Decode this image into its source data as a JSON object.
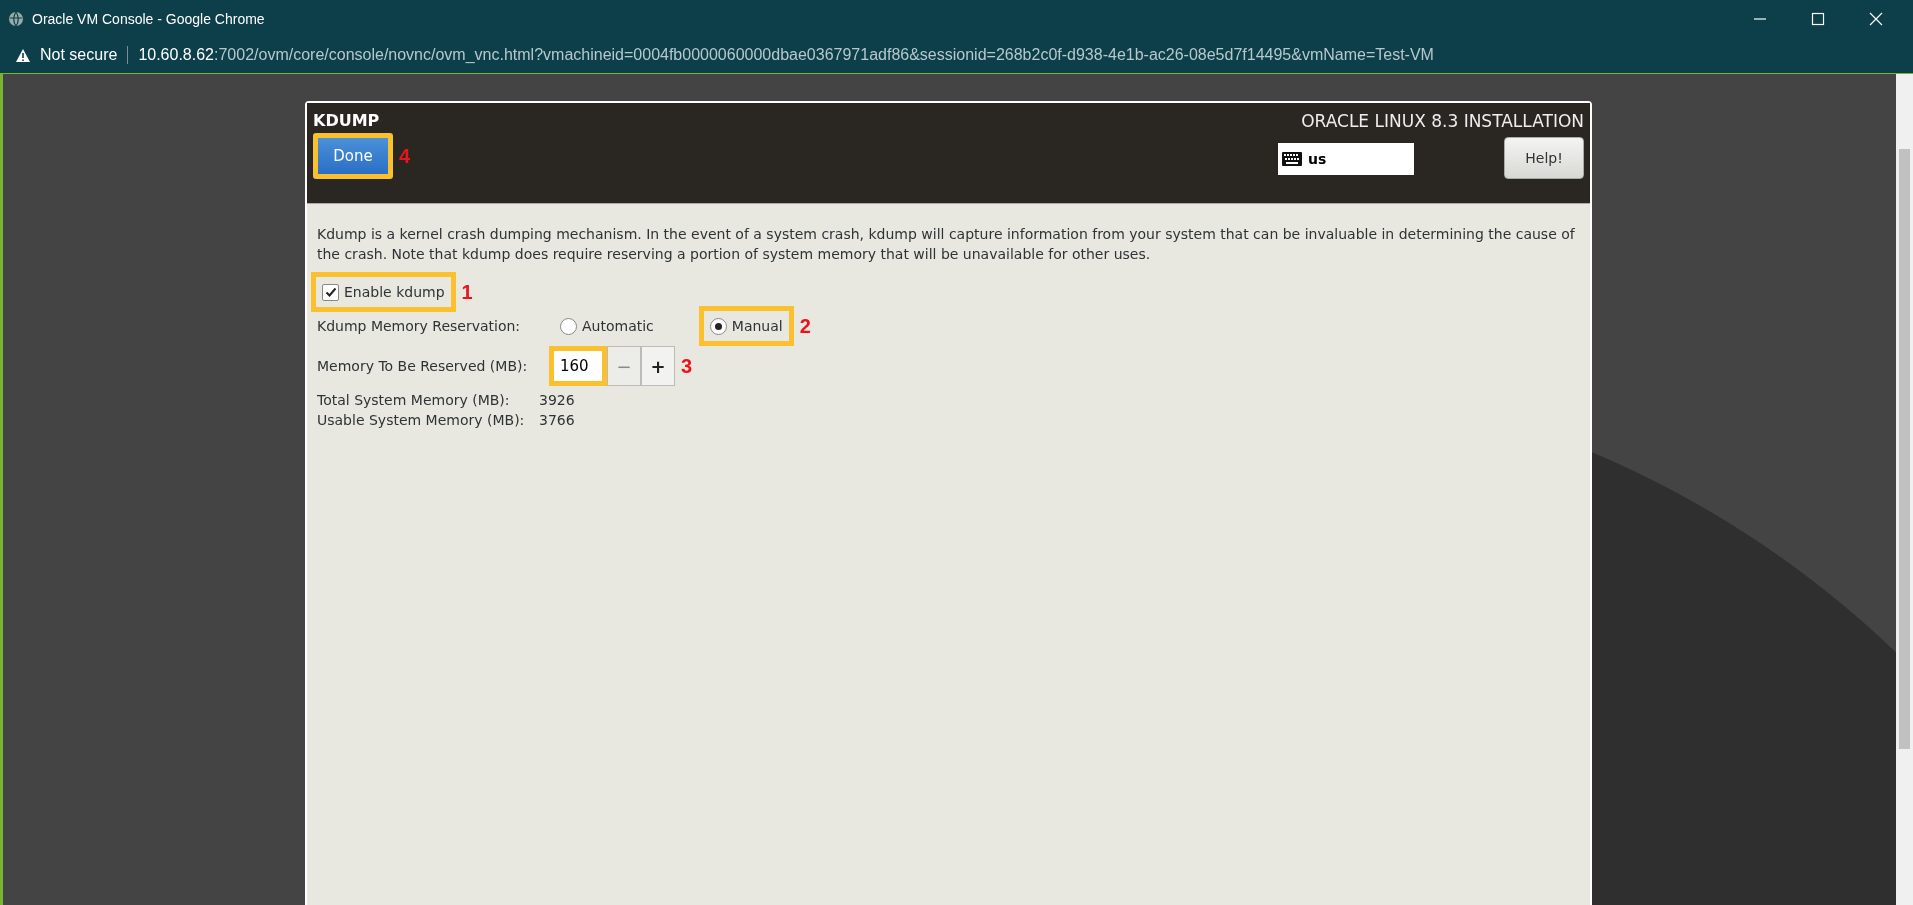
{
  "browser": {
    "title": "Oracle VM Console - Google Chrome",
    "security": "Not secure",
    "url_host": "10.60.8.62",
    "url_rest": ":7002/ovm/core/console/novnc/ovm_vnc.html?vmachineid=0004fb0000060000dbae0367971adf86&sessionid=268b2c0f-d938-4e1b-ac26-08e5d7f14495&vmName=Test-VM"
  },
  "header": {
    "title": "KDUMP",
    "product": "ORACLE LINUX 8.3 INSTALLATION",
    "keyboard": "us",
    "help": "Help!"
  },
  "done": {
    "label": "Done",
    "highlighted": true,
    "callout": "4"
  },
  "description": "Kdump is a kernel crash dumping mechanism. In the event of a system crash, kdump will capture information from your system that can be invaluable in determining the cause of the crash. Note that kdump does require reserving a portion of system memory that will be unavailable for other uses.",
  "enable": {
    "label": "Enable kdump",
    "checked": true,
    "highlighted": true,
    "callout": "1"
  },
  "reservation": {
    "label": "Kdump Memory Reservation:",
    "options": [
      {
        "label": "Automatic",
        "selected": false,
        "highlighted": false
      },
      {
        "label": "Manual",
        "selected": true,
        "highlighted": true,
        "callout": "2"
      }
    ]
  },
  "memory": {
    "label": "Memory To Be Reserved (MB):",
    "value": "160",
    "minus": "−",
    "plus": "+",
    "minus_disabled": true,
    "highlighted": true,
    "callout": "3"
  },
  "stats": [
    {
      "label": "Total System Memory (MB):",
      "value": "3926"
    },
    {
      "label": "Usable System Memory (MB):",
      "value": "3766"
    }
  ]
}
